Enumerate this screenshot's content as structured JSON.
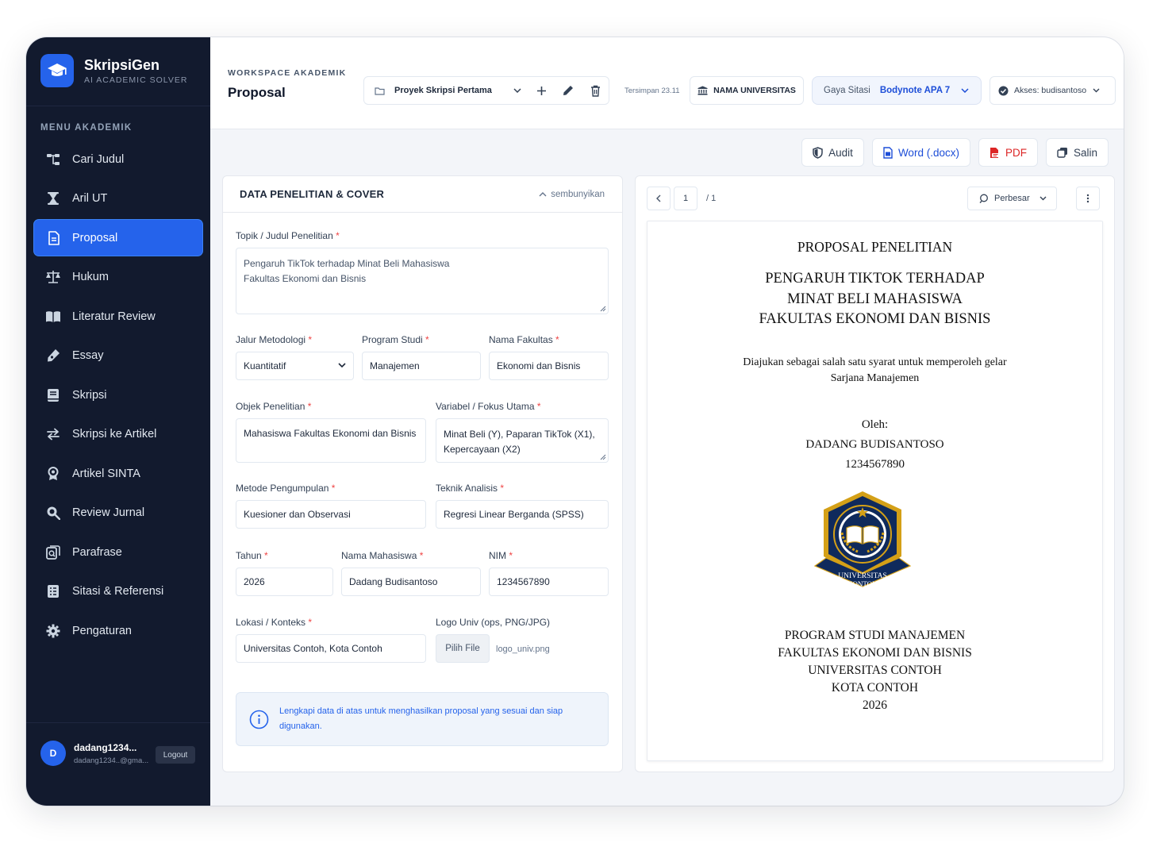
{
  "brand": {
    "name": "SkripsiGen",
    "tagline": "AI ACADEMIC SOLVER"
  },
  "sidebar": {
    "menu_title": "MENU AKADEMIK",
    "items": [
      {
        "label": "Cari Judul",
        "icon": "tree-icon"
      },
      {
        "label": "Aril UT",
        "icon": "hourglass-icon"
      },
      {
        "label": "Proposal",
        "icon": "document-icon",
        "active": true
      },
      {
        "label": "Hukum",
        "icon": "scale-icon"
      },
      {
        "label": "Literatur Review",
        "icon": "book-open-icon"
      },
      {
        "label": "Essay",
        "icon": "pen-icon"
      },
      {
        "label": "Skripsi",
        "icon": "book-icon"
      },
      {
        "label": "Skripsi ke Artikel",
        "icon": "swap-icon"
      },
      {
        "label": "Artikel SINTA",
        "icon": "award-icon"
      },
      {
        "label": "Review Jurnal",
        "icon": "magnify-icon"
      },
      {
        "label": "Parafrase",
        "icon": "copy-search-icon"
      },
      {
        "label": "Sitasi & Referensi",
        "icon": "list-icon"
      },
      {
        "label": "Pengaturan",
        "icon": "gear-icon"
      }
    ]
  },
  "user": {
    "initial": "D",
    "name": "dadang1234...",
    "email": "dadang1234..@gma...",
    "logout_label": "Logout"
  },
  "header": {
    "workspace_label": "WORKSPACE AKADEMIK",
    "title": "Proposal",
    "project": "Proyek Skripsi Pertama",
    "saved_text": "Tersimpan 23.11",
    "university_label": "NAMA UNIVERSITAS",
    "citation_label": "Gaya Sitasi",
    "citation_value": "Bodynote APA 7",
    "access_label": "Akses: budisantoso"
  },
  "actions": {
    "audit": "Audit",
    "word": "Word (.docx)",
    "pdf": "PDF",
    "copy": "Salin"
  },
  "form": {
    "title": "DATA PENELITIAN & COVER",
    "toggle_label": "sembunyikan",
    "topic": {
      "label": "Topik / Judul Penelitian",
      "value_line1": "Pengaruh TikTok terhadap Minat Beli Mahasiswa",
      "value_line2": "Fakultas Ekonomi dan Bisnis"
    },
    "methodology": {
      "label": "Jalur Metodologi",
      "value": "Kuantitatif"
    },
    "study_program": {
      "label": "Program Studi",
      "value": "Manajemen"
    },
    "faculty": {
      "label": "Nama Fakultas",
      "value": "Ekonomi dan Bisnis"
    },
    "object": {
      "label": "Objek Penelitian",
      "value": "Mahasiswa Fakultas Ekonomi dan Bisnis"
    },
    "variables": {
      "label": "Variabel / Fokus Utama",
      "value_line1": "Minat Beli (Y), Paparan TikTok (X1),",
      "value_line2": "Kepercayaan (X2)"
    },
    "collection": {
      "label": "Metode Pengumpulan",
      "value": "Kuesioner dan Observasi"
    },
    "analysis": {
      "label": "Teknik Analisis",
      "value": "Regresi Linear Berganda (SPSS)"
    },
    "year": {
      "label": "Tahun",
      "value": "2026"
    },
    "student_name": {
      "label": "Nama Mahasiswa",
      "value": "Dadang Budisantoso"
    },
    "nim": {
      "label": "NIM",
      "value": "1234567890"
    },
    "location": {
      "label": "Lokasi / Konteks",
      "value": "Universitas Contoh, Kota Contoh"
    },
    "logo": {
      "label": "Logo Univ (ops, PNG/JPG)",
      "button": "Pilih File",
      "file_name": "logo_univ.png"
    },
    "required_mark": "*",
    "info": "Lengkapi data di atas untuk menghasilkan proposal yang sesuai dan siap digunakan."
  },
  "preview": {
    "page": "1",
    "total": "/ 1",
    "zoom_label": "Perbesar",
    "doc": {
      "heading": "PROPOSAL PENELITIAN",
      "title_line1": "PENGARUH TIKTOK TERHADAP",
      "title_line2": "MINAT BELI MAHASISWA",
      "title_line3": "FAKULTAS EKONOMI DAN BISNIS",
      "purpose_line1": "Diajukan sebagai salah satu syarat untuk memperoleh gelar",
      "purpose_line2": "Sarjana Manajemen",
      "by": "Oleh:",
      "author": "DADANG BUDISANTOSO",
      "author_nim": "1234567890",
      "seal_text_1": "UNIVERSITAS",
      "seal_text_2": "CONTOH",
      "footer_line1": "PROGRAM STUDI MANAJEMEN",
      "footer_line2": "FAKULTAS EKONOMI DAN BISNIS",
      "footer_line3": "UNIVERSITAS CONTOH",
      "footer_line4": "KOTA CONTOH",
      "footer_line5": "2026"
    }
  },
  "colors": {
    "sidebar_bg": "#121a2e",
    "accent": "#2563eb",
    "danger": "#dc2626",
    "seal_navy": "#0f2a5c",
    "seal_gold": "#d4a017"
  }
}
